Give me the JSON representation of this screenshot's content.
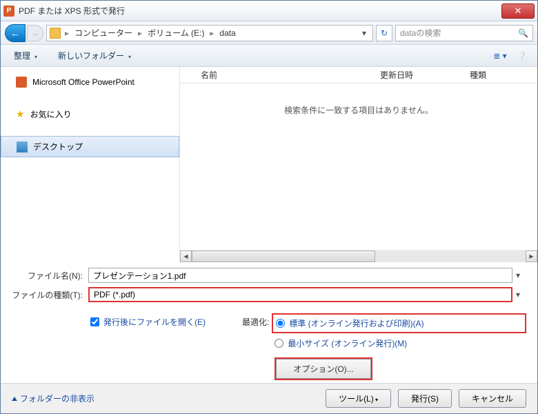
{
  "window_title": "PDF または XPS 形式で発行",
  "breadcrumb": {
    "seg1": "コンピューター",
    "seg2": "ボリューム (E:)",
    "seg3": "data"
  },
  "search_placeholder": "dataの検索",
  "toolbar": {
    "organize": "整理",
    "new_folder": "新しいフォルダー"
  },
  "sidebar": {
    "powerpoint": "Microsoft Office PowerPoint",
    "favorites": "お気に入り",
    "desktop": "デスクトップ"
  },
  "columns": {
    "name": "名前",
    "date": "更新日時",
    "type": "種類"
  },
  "empty_message": "検索条件に一致する項目はありません。",
  "filename_label": "ファイル名(N):",
  "filename_value": "プレゼンテーション1.pdf",
  "filetype_label": "ファイルの種類(T):",
  "filetype_value": "PDF (*.pdf)",
  "open_after_label": "発行後にファイルを開く(E)",
  "optimize_label": "最適化:",
  "radio_standard": "標準 (オンライン発行および印刷)(A)",
  "radio_minsize": "最小サイズ (オンライン発行)(M)",
  "options_button": "オプション(O)...",
  "footer": {
    "hide_folders": "フォルダーの非表示",
    "tools": "ツール(L)",
    "publish": "発行(S)",
    "cancel": "キャンセル"
  }
}
